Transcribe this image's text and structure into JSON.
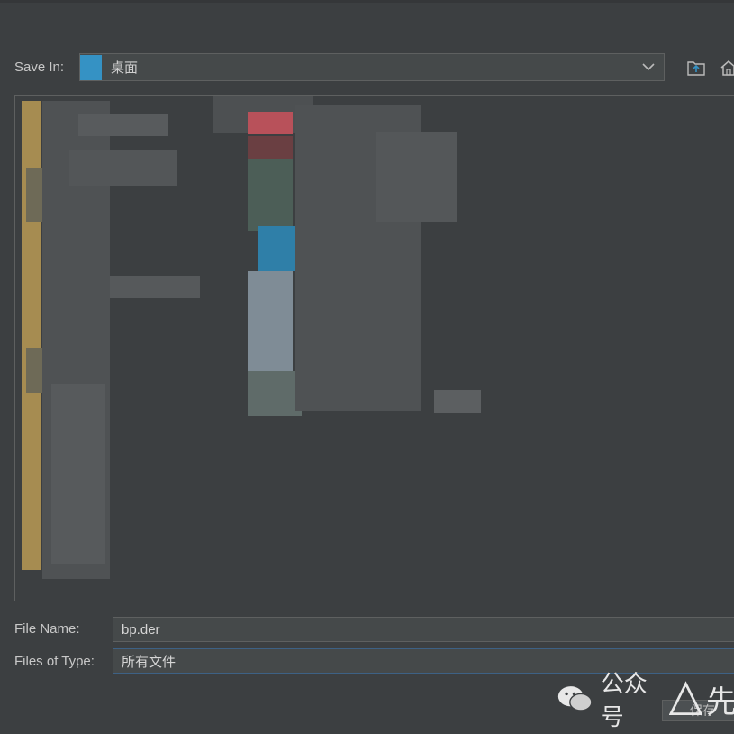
{
  "dialog": {
    "save_in_label": "Save In:",
    "save_in_value": "桌面",
    "file_name_label": "File Name:",
    "file_name_value": "bp.der",
    "files_of_type_label": "Files of Type:",
    "files_of_type_value": "所有文件",
    "save_button_label": "保存"
  },
  "toolbar": {
    "icons": [
      "up-folder-icon",
      "home-icon"
    ]
  },
  "watermark": {
    "text": "公众号",
    "text2": "先"
  },
  "colors": {
    "background": "#3c3f41",
    "field_bg": "#45494a",
    "border": "#5e6060",
    "focus_border": "#3d6185",
    "accent_blue": "#3592c4",
    "folder_yellow": "#d4a84b"
  }
}
